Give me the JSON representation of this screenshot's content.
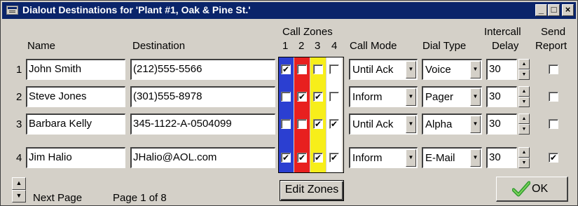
{
  "window": {
    "title": "Dialout Destinations for 'Plant #1, Oak & Pine St.'",
    "minimize": "_",
    "maximize": "□",
    "close": "×"
  },
  "headers": {
    "name": "Name",
    "destination": "Destination",
    "call_zones": "Call Zones",
    "zone_numbers": [
      "1",
      "2",
      "3",
      "4"
    ],
    "call_mode": "Call Mode",
    "dial_type": "Dial Type",
    "intercall_line1": "Intercall",
    "intercall_line2": "Delay",
    "send_line1": "Send",
    "send_line2": "Report"
  },
  "zone_colors": [
    "#2b3fd1",
    "#e8201f",
    "#f7ee1a",
    "#ffffff"
  ],
  "rows": [
    {
      "num": "1",
      "name": "John Smith",
      "destination": "(212)555-5566",
      "zones": [
        "✔",
        "",
        "",
        ""
      ],
      "call_mode": "Until Ack",
      "dial_type": "Voice",
      "delay": "30",
      "send_report": ""
    },
    {
      "num": "2",
      "name": "Steve Jones",
      "destination": "(301)555-8978",
      "zones": [
        "",
        "✔",
        "✔",
        ""
      ],
      "call_mode": "Inform",
      "dial_type": "Pager",
      "delay": "30",
      "send_report": ""
    },
    {
      "num": "3",
      "name": "Barbara Kelly",
      "destination": "345-1122-A-0504099",
      "zones": [
        "",
        "",
        "✔",
        "✔"
      ],
      "call_mode": "Until Ack",
      "dial_type": "Alpha",
      "delay": "30",
      "send_report": ""
    },
    {
      "num": "4",
      "name": "Jim Halio",
      "destination": "JHalio@AOL.com",
      "zones": [
        "✔",
        "✔",
        "✔",
        "✔"
      ],
      "call_mode": "Inform",
      "dial_type": "E-Mail",
      "delay": "30",
      "send_report": "✔"
    }
  ],
  "footer": {
    "next_page": "Next Page",
    "page_info": "Page 1 of 8",
    "edit_zones": "Edit Zones",
    "ok": "OK"
  },
  "icons": {
    "dropdown_arrow": "▼",
    "spin_up": "▲",
    "spin_down": "▼",
    "ok_check": "check-icon"
  }
}
